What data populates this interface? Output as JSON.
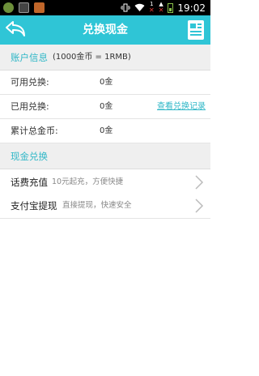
{
  "status_bar": {
    "time": "19:02",
    "network_label": "1"
  },
  "header": {
    "title": "兑换现金"
  },
  "account": {
    "section_title": "账户信息",
    "rate_note": "(1000金币 = 1RMB)",
    "rows": [
      {
        "label": "可用兑换:",
        "value": "0金"
      },
      {
        "label": "已用兑换:",
        "value": "0金",
        "link": "查看兑换记录"
      },
      {
        "label": "累计总金币:",
        "value": "0金"
      }
    ]
  },
  "exchange": {
    "section_title": "现金兑换",
    "options": [
      {
        "title": "话费充值",
        "desc": "10元起充，方便快捷"
      },
      {
        "title": "支付宝提现",
        "desc": "直接提现，快速安全"
      }
    ]
  },
  "colors": {
    "accent": "#2fc5d6",
    "link": "#2fb7c7"
  }
}
